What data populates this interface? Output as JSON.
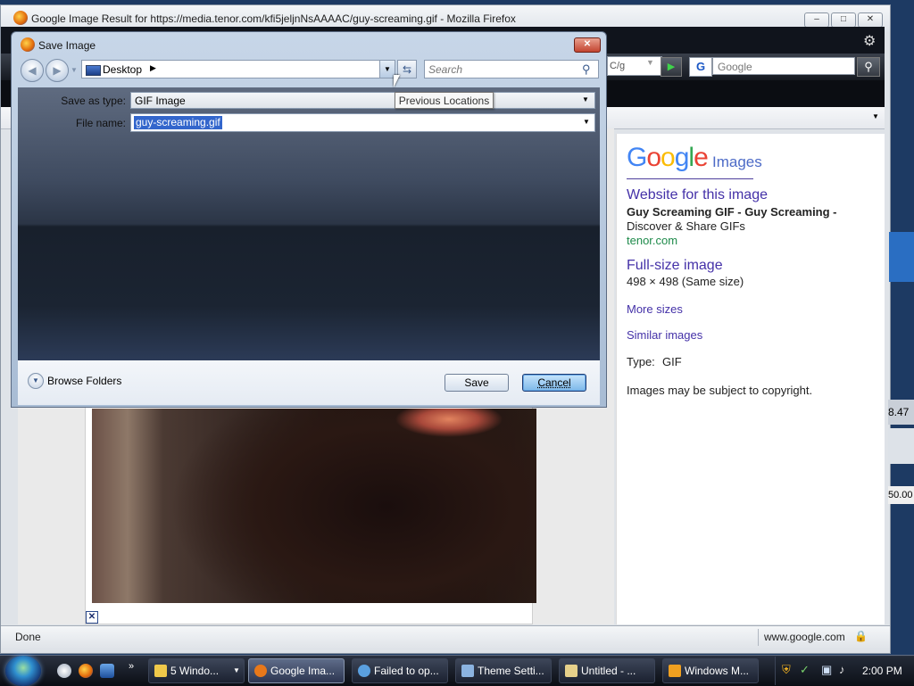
{
  "firefox": {
    "title": "Google Image Result for https://media.tenor.com/kfi5jeljnNsAAAAC/guy-screaming.gif - Mozilla Firefox",
    "caption_buttons": [
      "minimize",
      "maximize",
      "close"
    ],
    "navbar": {
      "url_fragment": "C/g",
      "search_placeholder": "Google"
    },
    "status_text": "Done",
    "status_host": "www.google.com"
  },
  "dialog": {
    "title": "Save Image",
    "location": "Desktop",
    "search_placeholder": "Search",
    "tooltip": "Previous Locations",
    "save_as_type_label": "Save as type:",
    "save_as_type_value": "GIF Image",
    "file_name_label": "File name:",
    "file_name_value": "guy-screaming.gif",
    "browse_folders": "Browse Folders",
    "save_button": "Save",
    "cancel_button": "Cancel"
  },
  "google_panel": {
    "logo": "Google",
    "logo_suffix": "Images",
    "website_link": "Website for this image",
    "result_title_line1": "Guy Screaming GIF - Guy Screaming -",
    "result_title_line2": "Discover & Share GIFs",
    "result_domain": "tenor.com",
    "fullsize_link": "Full-size image",
    "fullsize_dims": "498 × 498 (Same size)",
    "more_sizes": "More sizes",
    "similar_images": "Similar images",
    "type_label": "Type:",
    "type_value": "GIF",
    "copyright": "Images may be subject to copyright."
  },
  "background_fragments": {
    "time_fragment": "8.47",
    "value_fragment": "50.00"
  },
  "taskbar": {
    "items": [
      {
        "label": "5 Windo...",
        "icon": "folder-icon",
        "color": "#f0c94a"
      },
      {
        "label": "Google Ima...",
        "icon": "firefox-icon",
        "color": "#e8781a"
      },
      {
        "label": "Failed to op...",
        "icon": "globe-icon",
        "color": "#5aa0e0"
      },
      {
        "label": "Theme Setti...",
        "icon": "theme-icon",
        "color": "#8bb3e0"
      },
      {
        "label": "Untitled - ...",
        "icon": "paint-icon",
        "color": "#e6d08a"
      },
      {
        "label": "Windows M...",
        "icon": "media-player-icon",
        "color": "#f0a020"
      }
    ],
    "clock": "2:00 PM"
  }
}
